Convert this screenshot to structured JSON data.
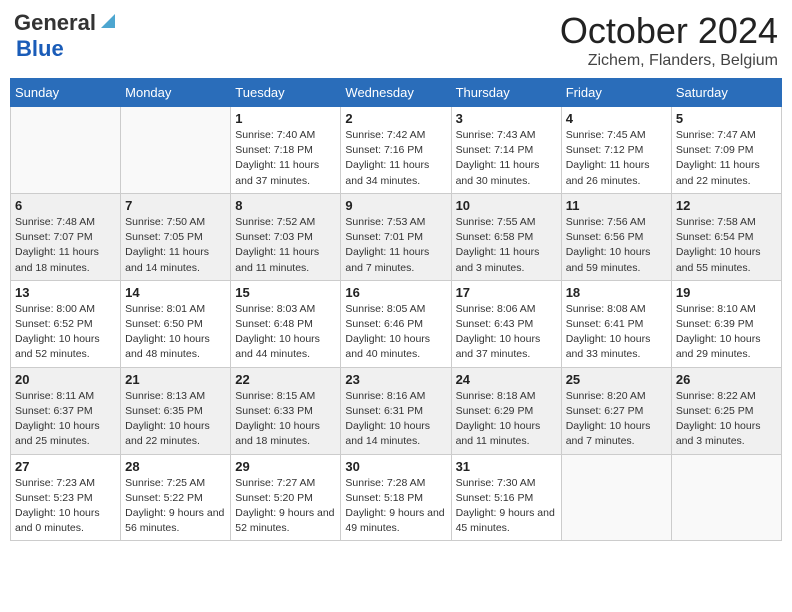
{
  "header": {
    "logo_general": "General",
    "logo_blue": "Blue",
    "title": "October 2024",
    "subtitle": "Zichem, Flanders, Belgium"
  },
  "weekdays": [
    "Sunday",
    "Monday",
    "Tuesday",
    "Wednesday",
    "Thursday",
    "Friday",
    "Saturday"
  ],
  "weeks": [
    [
      {
        "day": "",
        "info": ""
      },
      {
        "day": "",
        "info": ""
      },
      {
        "day": "1",
        "info": "Sunrise: 7:40 AM\nSunset: 7:18 PM\nDaylight: 11 hours and 37 minutes."
      },
      {
        "day": "2",
        "info": "Sunrise: 7:42 AM\nSunset: 7:16 PM\nDaylight: 11 hours and 34 minutes."
      },
      {
        "day": "3",
        "info": "Sunrise: 7:43 AM\nSunset: 7:14 PM\nDaylight: 11 hours and 30 minutes."
      },
      {
        "day": "4",
        "info": "Sunrise: 7:45 AM\nSunset: 7:12 PM\nDaylight: 11 hours and 26 minutes."
      },
      {
        "day": "5",
        "info": "Sunrise: 7:47 AM\nSunset: 7:09 PM\nDaylight: 11 hours and 22 minutes."
      }
    ],
    [
      {
        "day": "6",
        "info": "Sunrise: 7:48 AM\nSunset: 7:07 PM\nDaylight: 11 hours and 18 minutes."
      },
      {
        "day": "7",
        "info": "Sunrise: 7:50 AM\nSunset: 7:05 PM\nDaylight: 11 hours and 14 minutes."
      },
      {
        "day": "8",
        "info": "Sunrise: 7:52 AM\nSunset: 7:03 PM\nDaylight: 11 hours and 11 minutes."
      },
      {
        "day": "9",
        "info": "Sunrise: 7:53 AM\nSunset: 7:01 PM\nDaylight: 11 hours and 7 minutes."
      },
      {
        "day": "10",
        "info": "Sunrise: 7:55 AM\nSunset: 6:58 PM\nDaylight: 11 hours and 3 minutes."
      },
      {
        "day": "11",
        "info": "Sunrise: 7:56 AM\nSunset: 6:56 PM\nDaylight: 10 hours and 59 minutes."
      },
      {
        "day": "12",
        "info": "Sunrise: 7:58 AM\nSunset: 6:54 PM\nDaylight: 10 hours and 55 minutes."
      }
    ],
    [
      {
        "day": "13",
        "info": "Sunrise: 8:00 AM\nSunset: 6:52 PM\nDaylight: 10 hours and 52 minutes."
      },
      {
        "day": "14",
        "info": "Sunrise: 8:01 AM\nSunset: 6:50 PM\nDaylight: 10 hours and 48 minutes."
      },
      {
        "day": "15",
        "info": "Sunrise: 8:03 AM\nSunset: 6:48 PM\nDaylight: 10 hours and 44 minutes."
      },
      {
        "day": "16",
        "info": "Sunrise: 8:05 AM\nSunset: 6:46 PM\nDaylight: 10 hours and 40 minutes."
      },
      {
        "day": "17",
        "info": "Sunrise: 8:06 AM\nSunset: 6:43 PM\nDaylight: 10 hours and 37 minutes."
      },
      {
        "day": "18",
        "info": "Sunrise: 8:08 AM\nSunset: 6:41 PM\nDaylight: 10 hours and 33 minutes."
      },
      {
        "day": "19",
        "info": "Sunrise: 8:10 AM\nSunset: 6:39 PM\nDaylight: 10 hours and 29 minutes."
      }
    ],
    [
      {
        "day": "20",
        "info": "Sunrise: 8:11 AM\nSunset: 6:37 PM\nDaylight: 10 hours and 25 minutes."
      },
      {
        "day": "21",
        "info": "Sunrise: 8:13 AM\nSunset: 6:35 PM\nDaylight: 10 hours and 22 minutes."
      },
      {
        "day": "22",
        "info": "Sunrise: 8:15 AM\nSunset: 6:33 PM\nDaylight: 10 hours and 18 minutes."
      },
      {
        "day": "23",
        "info": "Sunrise: 8:16 AM\nSunset: 6:31 PM\nDaylight: 10 hours and 14 minutes."
      },
      {
        "day": "24",
        "info": "Sunrise: 8:18 AM\nSunset: 6:29 PM\nDaylight: 10 hours and 11 minutes."
      },
      {
        "day": "25",
        "info": "Sunrise: 8:20 AM\nSunset: 6:27 PM\nDaylight: 10 hours and 7 minutes."
      },
      {
        "day": "26",
        "info": "Sunrise: 8:22 AM\nSunset: 6:25 PM\nDaylight: 10 hours and 3 minutes."
      }
    ],
    [
      {
        "day": "27",
        "info": "Sunrise: 7:23 AM\nSunset: 5:23 PM\nDaylight: 10 hours and 0 minutes."
      },
      {
        "day": "28",
        "info": "Sunrise: 7:25 AM\nSunset: 5:22 PM\nDaylight: 9 hours and 56 minutes."
      },
      {
        "day": "29",
        "info": "Sunrise: 7:27 AM\nSunset: 5:20 PM\nDaylight: 9 hours and 52 minutes."
      },
      {
        "day": "30",
        "info": "Sunrise: 7:28 AM\nSunset: 5:18 PM\nDaylight: 9 hours and 49 minutes."
      },
      {
        "day": "31",
        "info": "Sunrise: 7:30 AM\nSunset: 5:16 PM\nDaylight: 9 hours and 45 minutes."
      },
      {
        "day": "",
        "info": ""
      },
      {
        "day": "",
        "info": ""
      }
    ]
  ]
}
